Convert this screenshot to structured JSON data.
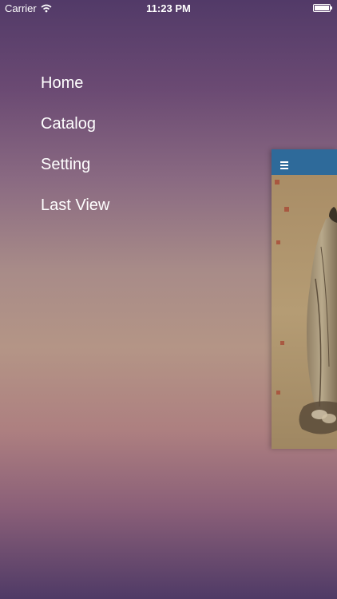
{
  "status_bar": {
    "carrier": "Carrier",
    "time": "11:23 PM",
    "icons": [
      "wifi-icon",
      "battery-icon"
    ]
  },
  "menu": {
    "items": [
      {
        "label": "Home"
      },
      {
        "label": "Catalog"
      },
      {
        "label": "Setting"
      },
      {
        "label": "Last View"
      }
    ]
  },
  "content_panel": {
    "nav_icon": "hamburger-menu-icon",
    "nav_color": "#2e6a9a",
    "image": "traditional-chinese-figure-painting"
  }
}
